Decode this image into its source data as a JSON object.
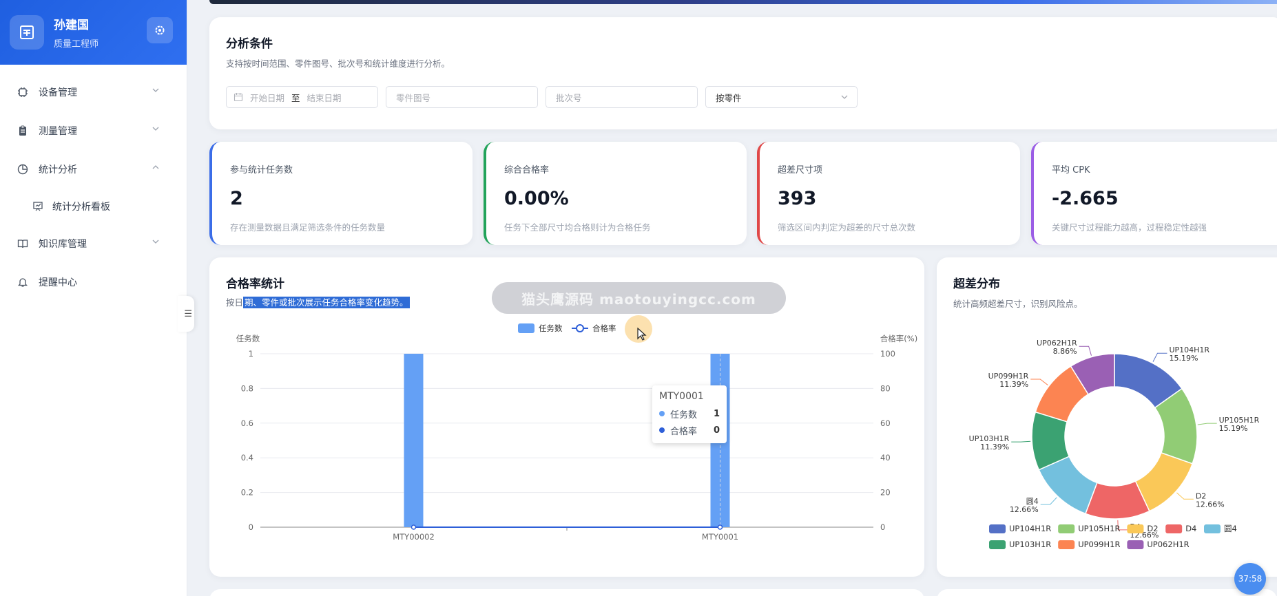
{
  "user": {
    "name": "孙建国",
    "role": "质量工程师"
  },
  "nav": {
    "items": [
      {
        "label": "设备管理",
        "icon": "chip-icon",
        "expanded": false
      },
      {
        "label": "测量管理",
        "icon": "clipboard-icon",
        "expanded": false
      },
      {
        "label": "统计分析",
        "icon": "pie-icon",
        "expanded": true
      },
      {
        "label": "知识库管理",
        "icon": "book-icon",
        "expanded": false
      },
      {
        "label": "提醒中心",
        "icon": "bell-icon",
        "expanded": false
      }
    ],
    "sub_item": {
      "label": "统计分析看板",
      "icon": "board-icon"
    }
  },
  "filters": {
    "title": "分析条件",
    "subtitle": "支持按时间范围、零件图号、批次号和统计维度进行分析。",
    "start_placeholder": "开始日期",
    "separator": "至",
    "end_placeholder": "结束日期",
    "part_placeholder": "零件图号",
    "batch_placeholder": "批次号",
    "dimension_value": "按零件"
  },
  "stats": [
    {
      "label": "参与统计任务数",
      "value": "2",
      "desc": "存在测量数据且满足筛选条件的任务数量",
      "color": "#3b6de8"
    },
    {
      "label": "综合合格率",
      "value": "0.00%",
      "desc": "任务下全部尺寸均合格则计为合格任务",
      "color": "#22a35a"
    },
    {
      "label": "超差尺寸项",
      "value": "393",
      "desc": "筛选区间内判定为超差的尺寸总次数",
      "color": "#e04848"
    },
    {
      "label": "平均 CPK",
      "value": "-2.665",
      "desc": "关键尺寸过程能力越高，过程稳定性越强",
      "color": "#9b5de5"
    }
  ],
  "pass_rate": {
    "title": "合格率统计",
    "subtitle_plain": "按日",
    "subtitle_selected": "期、零件或批次展示任务合格率变化趋势。",
    "watermark": "猫头鹰源码 maotouyingcc.com",
    "tooltip": {
      "title": "MTY0001",
      "rows": [
        {
          "name": "任务数",
          "value": "1",
          "color": "#64a0f5"
        },
        {
          "name": "合格率",
          "value": "0",
          "color": "#2e5fd8"
        }
      ]
    }
  },
  "deviation": {
    "title": "超差分布",
    "subtitle": "统计高频超差尺寸，识别风险点。"
  },
  "timer": "37:58",
  "chart_data": [
    {
      "type": "bar",
      "title": "合格率统计",
      "categories": [
        "MTY00002",
        "MTY0001"
      ],
      "series": [
        {
          "name": "任务数",
          "type": "bar",
          "axis": "left",
          "values": [
            1,
            1
          ],
          "color": "#64a0f5"
        },
        {
          "name": "合格率",
          "type": "line",
          "axis": "right",
          "values": [
            0,
            0
          ],
          "color": "#2e5fd8"
        }
      ],
      "ylabel": "任务数",
      "ylabel_right": "合格率(%)",
      "ylim": [
        0,
        1
      ],
      "yticks": [
        "0",
        "0.2",
        "0.4",
        "0.6",
        "0.8",
        "1"
      ],
      "ylim_right": [
        0,
        100
      ],
      "yticks_right": [
        "0",
        "20",
        "40",
        "60",
        "80",
        "100"
      ],
      "legend": "top-center",
      "grid": true
    },
    {
      "type": "pie",
      "title": "超差分布",
      "labels": [
        "UP104H1R",
        "UP105H1R",
        "D2",
        "D4",
        "圆4",
        "UP103H1R",
        "UP099H1R",
        "UP062H1R"
      ],
      "values": [
        15.19,
        15.19,
        12.66,
        12.66,
        12.66,
        11.39,
        11.39,
        8.86
      ],
      "value_labels": [
        "15.19%",
        "15.19%",
        "12.66%",
        "12.66%",
        "12.66%",
        "11.39%",
        "11.39%",
        "8.86%"
      ],
      "colors": [
        "#5470c6",
        "#91cc75",
        "#fac858",
        "#ee6666",
        "#73c0de",
        "#3ba272",
        "#fc8452",
        "#9a60b4"
      ],
      "donut": true,
      "legend": "bottom"
    }
  ]
}
